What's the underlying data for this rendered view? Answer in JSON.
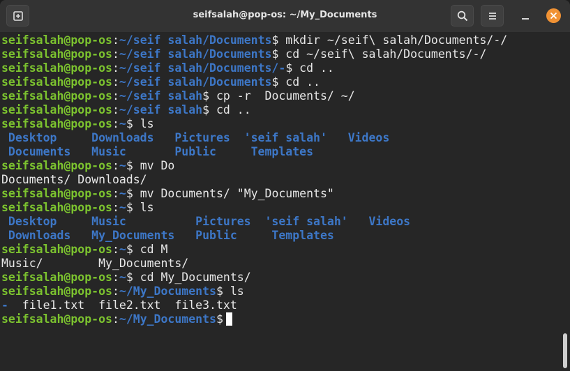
{
  "window": {
    "title": "seifsalah@pop-os: ~/My_Documents",
    "accent_close": "#f19234"
  },
  "titlebar": {
    "new_tab_icon": "new-tab-icon",
    "search_icon": "search-icon",
    "menu_icon": "hamburger-menu-icon",
    "minimize_icon": "minimize-icon",
    "close_icon": "close-icon"
  },
  "colors": {
    "user": "#7cc32f",
    "path": "#3d77c7",
    "dir": "#3d77c7",
    "text": "#e8e8e8"
  },
  "terminal": {
    "lines": [
      [
        {
          "t": "seifsalah@pop-os",
          "c": "u"
        },
        {
          "t": ":",
          "c": "w"
        },
        {
          "t": "~/seif salah/Documents",
          "c": "p"
        },
        {
          "t": "$ mkdir ~/seif\\ salah/Documents/-/",
          "c": "w"
        }
      ],
      [
        {
          "t": "seifsalah@pop-os",
          "c": "u"
        },
        {
          "t": ":",
          "c": "w"
        },
        {
          "t": "~/seif salah/Documents",
          "c": "p"
        },
        {
          "t": "$ cd ~/seif\\ salah/Documents/-/",
          "c": "w"
        }
      ],
      [
        {
          "t": "seifsalah@pop-os",
          "c": "u"
        },
        {
          "t": ":",
          "c": "w"
        },
        {
          "t": "~/seif salah/Documents/-",
          "c": "p"
        },
        {
          "t": "$ cd ..",
          "c": "w"
        }
      ],
      [
        {
          "t": "seifsalah@pop-os",
          "c": "u"
        },
        {
          "t": ":",
          "c": "w"
        },
        {
          "t": "~/seif salah/Documents",
          "c": "p"
        },
        {
          "t": "$ cd ..",
          "c": "w"
        }
      ],
      [
        {
          "t": "seifsalah@pop-os",
          "c": "u"
        },
        {
          "t": ":",
          "c": "w"
        },
        {
          "t": "~/seif salah",
          "c": "p"
        },
        {
          "t": "$ cp -r  Documents/ ~/",
          "c": "w"
        }
      ],
      [
        {
          "t": "seifsalah@pop-os",
          "c": "u"
        },
        {
          "t": ":",
          "c": "w"
        },
        {
          "t": "~/seif salah",
          "c": "p"
        },
        {
          "t": "$ cd ..",
          "c": "w"
        }
      ],
      [
        {
          "t": "seifsalah@pop-os",
          "c": "u"
        },
        {
          "t": ":",
          "c": "w"
        },
        {
          "t": "~",
          "c": "p"
        },
        {
          "t": "$ ls",
          "c": "w"
        }
      ],
      [
        {
          "t": " Desktop     Downloads   Pictures  'seif salah'   Videos",
          "c": "d"
        }
      ],
      [
        {
          "t": " Documents   Music       Public     Templates",
          "c": "d"
        }
      ],
      [
        {
          "t": "seifsalah@pop-os",
          "c": "u"
        },
        {
          "t": ":",
          "c": "w"
        },
        {
          "t": "~",
          "c": "p"
        },
        {
          "t": "$ mv Do",
          "c": "w"
        }
      ],
      [
        {
          "t": "Documents/ Downloads/",
          "c": "w"
        }
      ],
      [
        {
          "t": "seifsalah@pop-os",
          "c": "u"
        },
        {
          "t": ":",
          "c": "w"
        },
        {
          "t": "~",
          "c": "p"
        },
        {
          "t": "$ mv Documents/ \"My_Documents\"",
          "c": "w"
        }
      ],
      [
        {
          "t": "seifsalah@pop-os",
          "c": "u"
        },
        {
          "t": ":",
          "c": "w"
        },
        {
          "t": "~",
          "c": "p"
        },
        {
          "t": "$ ls",
          "c": "w"
        }
      ],
      [
        {
          "t": " Desktop     Music          Pictures  'seif salah'   Videos",
          "c": "d"
        }
      ],
      [
        {
          "t": " Downloads   My_Documents   Public     Templates",
          "c": "d"
        }
      ],
      [
        {
          "t": "seifsalah@pop-os",
          "c": "u"
        },
        {
          "t": ":",
          "c": "w"
        },
        {
          "t": "~",
          "c": "p"
        },
        {
          "t": "$ cd M",
          "c": "w"
        }
      ],
      [
        {
          "t": "Music/        My_Documents/",
          "c": "w"
        }
      ],
      [
        {
          "t": "seifsalah@pop-os",
          "c": "u"
        },
        {
          "t": ":",
          "c": "w"
        },
        {
          "t": "~",
          "c": "p"
        },
        {
          "t": "$ cd My_Documents/",
          "c": "w"
        }
      ],
      [
        {
          "t": "seifsalah@pop-os",
          "c": "u"
        },
        {
          "t": ":",
          "c": "w"
        },
        {
          "t": "~/My_Documents",
          "c": "p"
        },
        {
          "t": "$ ls",
          "c": "w"
        }
      ],
      [
        {
          "t": "-",
          "c": "d"
        },
        {
          "t": "  file1.txt  file2.txt  file3.txt",
          "c": "w"
        }
      ],
      [
        {
          "t": "seifsalah@pop-os",
          "c": "u"
        },
        {
          "t": ":",
          "c": "w"
        },
        {
          "t": "~/My_Documents",
          "c": "p"
        },
        {
          "t": "$",
          "c": "w"
        }
      ]
    ]
  }
}
